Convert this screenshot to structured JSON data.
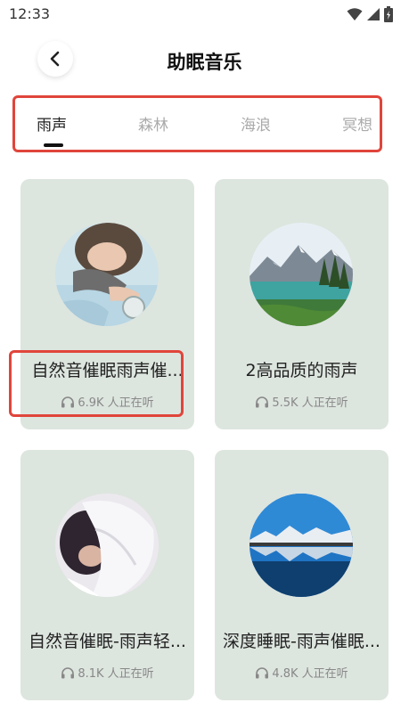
{
  "status_bar": {
    "time": "12:33"
  },
  "header": {
    "title": "助眠音乐"
  },
  "tabs": [
    {
      "label": "雨声",
      "active": true
    },
    {
      "label": "森林",
      "active": false
    },
    {
      "label": "海浪",
      "active": false
    },
    {
      "label": "冥想",
      "active": false
    }
  ],
  "cards": [
    {
      "title": "自然音催眠雨声催...",
      "listeners": "6.9K 人正在听",
      "image": "person-sleeping-with-alarm-clock"
    },
    {
      "title": "2高品质的雨声",
      "listeners": "5.5K 人正在听",
      "image": "mountain-lake-landscape"
    },
    {
      "title": "自然音催眠-雨声轻...",
      "listeners": "8.1K 人正在听",
      "image": "person-sleeping-on-pillow"
    },
    {
      "title": "深度睡眠-雨声催眠...",
      "listeners": "4.8K 人正在听",
      "image": "snowy-mountains-reflection"
    }
  ],
  "colors": {
    "card_bg": "#dde5df",
    "highlight": "#e0453b"
  },
  "icons": [
    "wifi-icon",
    "signal-icon",
    "battery-icon",
    "back-arrow-icon",
    "headphones-icon"
  ]
}
